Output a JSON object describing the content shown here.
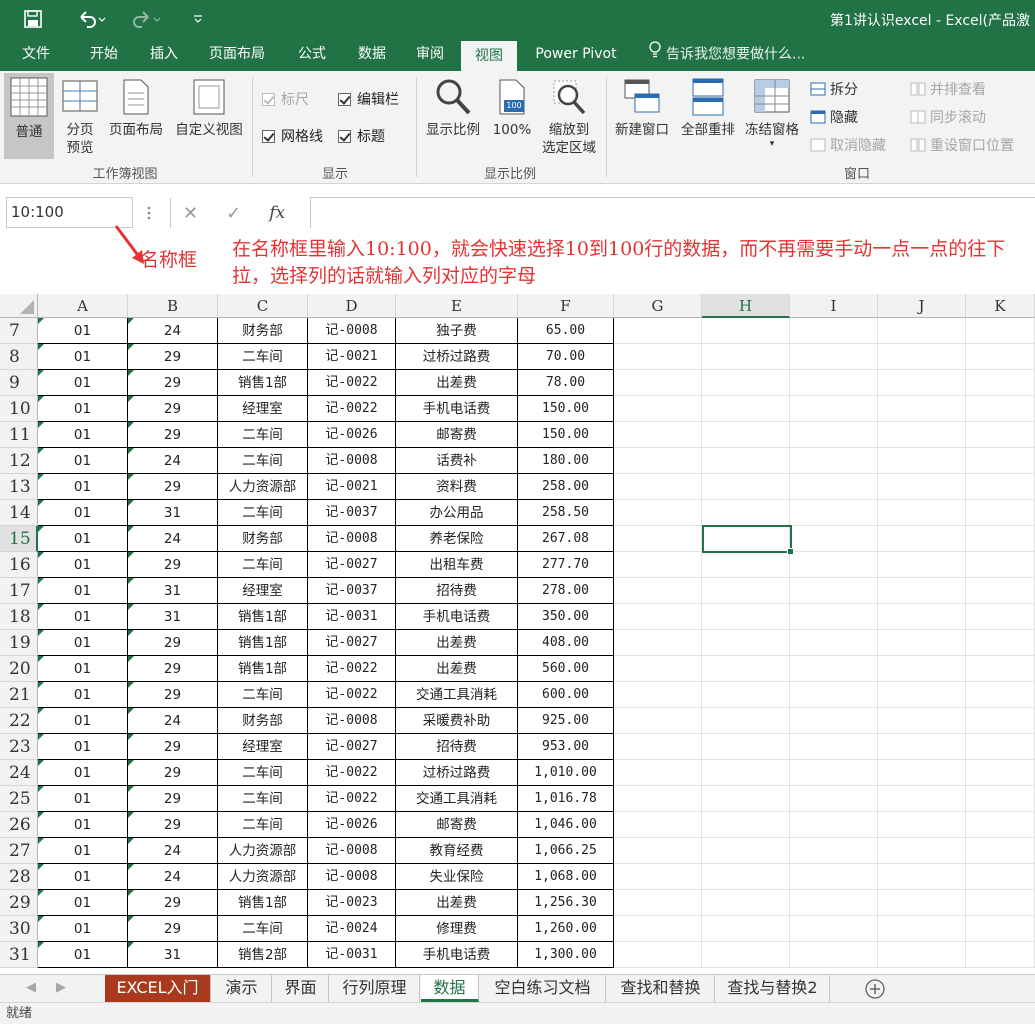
{
  "titlebar": {
    "title": "第1讲认识excel - Excel(产品激",
    "save_icon": "save-icon",
    "undo_icon": "undo-icon",
    "redo_icon": "redo-icon",
    "customize_icon": "customize-icon"
  },
  "tabs": [
    "文件",
    "开始",
    "插入",
    "页面布局",
    "公式",
    "数据",
    "审阅",
    "视图",
    "Power Pivot"
  ],
  "active_tab": "视图",
  "tellme": "告诉我您想要做什么...",
  "ribbon": {
    "workbook_views": {
      "label": "工作簿视图",
      "normal": "普通",
      "page_break_1": "分页",
      "page_break_2": "预览",
      "page_layout": "页面布局",
      "custom_views": "自定义视图"
    },
    "show": {
      "label": "显示",
      "ruler": "标尺",
      "formula_bar": "编辑栏",
      "gridlines": "网格线",
      "headings": "标题"
    },
    "zoom": {
      "label": "显示比例",
      "zoom": "显示比例",
      "hundred": "100%",
      "hundred_icon_text": "100",
      "zoom_selection_1": "缩放到",
      "zoom_selection_2": "选定区域"
    },
    "window": {
      "label": "窗口",
      "new_window": "新建窗口",
      "arrange_all": "全部重排",
      "freeze_panes": "冻结窗格",
      "split": "拆分",
      "hide": "隐藏",
      "unhide": "取消隐藏",
      "side_by_side": "并排查看",
      "sync_scroll": "同步滚动",
      "reset_position": "重设窗口位置"
    }
  },
  "formula_bar": {
    "name_box": "10:100",
    "cancel": "✕",
    "enter": "✓",
    "fx": "fx",
    "value": ""
  },
  "annotation": {
    "label": "名称框",
    "text": "在名称框里输入10:100，就会快速选择10到100行的数据，而不再需要手动一点一点的往下拉，选择列的话就输入列对应的字母"
  },
  "columns": [
    "A",
    "B",
    "C",
    "D",
    "E",
    "F",
    "G",
    "H",
    "I",
    "J",
    "K"
  ],
  "active_column": "H",
  "active_row": 15,
  "rows": [
    {
      "n": 7,
      "a": "01",
      "b": "24",
      "c": "财务部",
      "d": "记-0008",
      "e": "独子费",
      "f": "65.00"
    },
    {
      "n": 8,
      "a": "01",
      "b": "29",
      "c": "二车间",
      "d": "记-0021",
      "e": "过桥过路费",
      "f": "70.00"
    },
    {
      "n": 9,
      "a": "01",
      "b": "29",
      "c": "销售1部",
      "d": "记-0022",
      "e": "出差费",
      "f": "78.00"
    },
    {
      "n": 10,
      "a": "01",
      "b": "29",
      "c": "经理室",
      "d": "记-0022",
      "e": "手机电话费",
      "f": "150.00"
    },
    {
      "n": 11,
      "a": "01",
      "b": "29",
      "c": "二车间",
      "d": "记-0026",
      "e": "邮寄费",
      "f": "150.00"
    },
    {
      "n": 12,
      "a": "01",
      "b": "24",
      "c": "二车间",
      "d": "记-0008",
      "e": "话费补",
      "f": "180.00"
    },
    {
      "n": 13,
      "a": "01",
      "b": "29",
      "c": "人力资源部",
      "d": "记-0021",
      "e": "资料费",
      "f": "258.00"
    },
    {
      "n": 14,
      "a": "01",
      "b": "31",
      "c": "二车间",
      "d": "记-0037",
      "e": "办公用品",
      "f": "258.50"
    },
    {
      "n": 15,
      "a": "01",
      "b": "24",
      "c": "财务部",
      "d": "记-0008",
      "e": "养老保险",
      "f": "267.08"
    },
    {
      "n": 16,
      "a": "01",
      "b": "29",
      "c": "二车间",
      "d": "记-0027",
      "e": "出租车费",
      "f": "277.70"
    },
    {
      "n": 17,
      "a": "01",
      "b": "31",
      "c": "经理室",
      "d": "记-0037",
      "e": "招待费",
      "f": "278.00"
    },
    {
      "n": 18,
      "a": "01",
      "b": "31",
      "c": "销售1部",
      "d": "记-0031",
      "e": "手机电话费",
      "f": "350.00"
    },
    {
      "n": 19,
      "a": "01",
      "b": "29",
      "c": "销售1部",
      "d": "记-0027",
      "e": "出差费",
      "f": "408.00"
    },
    {
      "n": 20,
      "a": "01",
      "b": "29",
      "c": "销售1部",
      "d": "记-0022",
      "e": "出差费",
      "f": "560.00"
    },
    {
      "n": 21,
      "a": "01",
      "b": "29",
      "c": "二车间",
      "d": "记-0022",
      "e": "交通工具消耗",
      "f": "600.00"
    },
    {
      "n": 22,
      "a": "01",
      "b": "24",
      "c": "财务部",
      "d": "记-0008",
      "e": "采暖费补助",
      "f": "925.00"
    },
    {
      "n": 23,
      "a": "01",
      "b": "29",
      "c": "经理室",
      "d": "记-0027",
      "e": "招待费",
      "f": "953.00"
    },
    {
      "n": 24,
      "a": "01",
      "b": "29",
      "c": "二车间",
      "d": "记-0022",
      "e": "过桥过路费",
      "f": "1,010.00"
    },
    {
      "n": 25,
      "a": "01",
      "b": "29",
      "c": "二车间",
      "d": "记-0022",
      "e": "交通工具消耗",
      "f": "1,016.78"
    },
    {
      "n": 26,
      "a": "01",
      "b": "29",
      "c": "二车间",
      "d": "记-0026",
      "e": "邮寄费",
      "f": "1,046.00"
    },
    {
      "n": 27,
      "a": "01",
      "b": "24",
      "c": "人力资源部",
      "d": "记-0008",
      "e": "教育经费",
      "f": "1,066.25"
    },
    {
      "n": 28,
      "a": "01",
      "b": "24",
      "c": "人力资源部",
      "d": "记-0008",
      "e": "失业保险",
      "f": "1,068.00"
    },
    {
      "n": 29,
      "a": "01",
      "b": "29",
      "c": "销售1部",
      "d": "记-0023",
      "e": "出差费",
      "f": "1,256.30"
    },
    {
      "n": 30,
      "a": "01",
      "b": "29",
      "c": "二车间",
      "d": "记-0024",
      "e": "修理费",
      "f": "1,260.00"
    },
    {
      "n": 31,
      "a": "01",
      "b": "31",
      "c": "销售2部",
      "d": "记-0031",
      "e": "手机电话费",
      "f": "1,300.00"
    }
  ],
  "sheet_tabs": [
    "EXCEL入门",
    "演示",
    "界面",
    "行列原理",
    "数据",
    "空白练习文档",
    "查找和替换",
    "查找与替换2"
  ],
  "active_sheet": "数据",
  "status": "就绪",
  "colors": {
    "excel_green": "#217346",
    "annotation_red": "#e53333",
    "sheet_tab_red": "#a93a1e"
  }
}
